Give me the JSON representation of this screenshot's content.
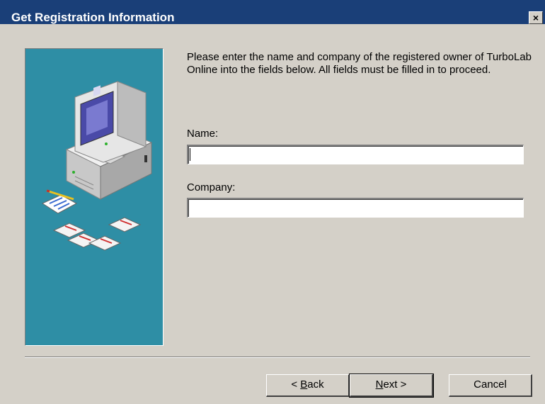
{
  "window": {
    "title": "Get Registration Information",
    "close_glyph": "×"
  },
  "instructions": "Please enter the name and company of the registered owner of TurboLab Online into the fields below. All fields must be filled in to proceed.",
  "form": {
    "name_label": "Name:",
    "name_value": "",
    "company_label": "Company:",
    "company_value": ""
  },
  "buttons": {
    "back_prefix": "< ",
    "back_mnemonic": "B",
    "back_rest": "ack",
    "next_mnemonic": "N",
    "next_rest": "ext >",
    "cancel": "Cancel"
  },
  "colors": {
    "titlebar": "#1a3f78",
    "panel": "#2e8ea5",
    "dialog": "#d4d0c8"
  },
  "illustration": {
    "icons": [
      "computer-icon",
      "notepad-pencil-icon",
      "floppy-disk-icon"
    ]
  }
}
